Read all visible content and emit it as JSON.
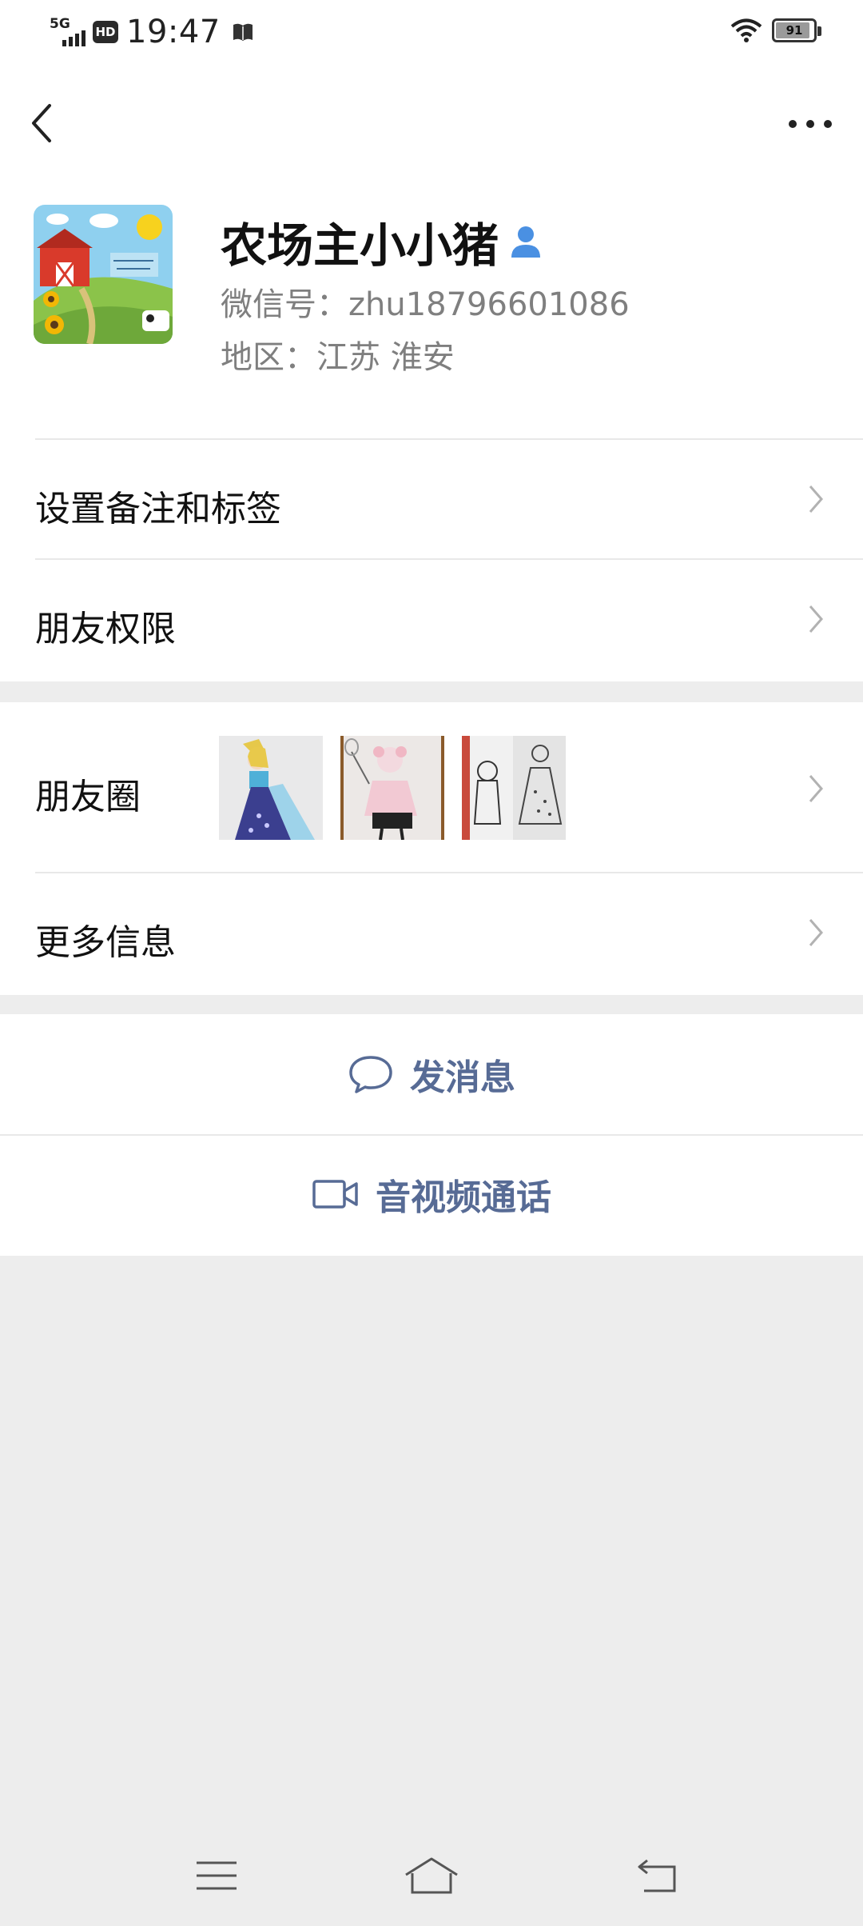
{
  "status_bar": {
    "network": "5G",
    "hd_badge": "HD",
    "time": "19:47",
    "battery_percent": "91",
    "battery_level": 0.91,
    "icons": [
      "signal-icon",
      "book-icon",
      "wifi-icon",
      "battery-icon"
    ]
  },
  "nav": {
    "back_icon": "back-arrow-icon",
    "more_icon": "more-dots-icon"
  },
  "profile": {
    "name": "农场主小小猪",
    "wechat_id": "微信号：zhu18796601086",
    "region": "地区：江苏  淮安",
    "badge_icon": "person-icon",
    "accent_color": "#4a90e2"
  },
  "menu_group_1": {
    "items": [
      {
        "label": "设置备注和标签"
      },
      {
        "label": "朋友权限"
      }
    ]
  },
  "menu_group_2": {
    "moments_label": "朋友圈",
    "moments_thumbnails": [
      "princess-drawing-1",
      "girl-drawing-2",
      "sketch-drawing-3"
    ],
    "more_info_label": "更多信息"
  },
  "actions": {
    "message_label": "发消息",
    "call_label": "音视频通话",
    "link_color": "#576b95"
  },
  "system_nav": {
    "icons": [
      "menu-icon",
      "home-icon",
      "return-icon"
    ]
  }
}
